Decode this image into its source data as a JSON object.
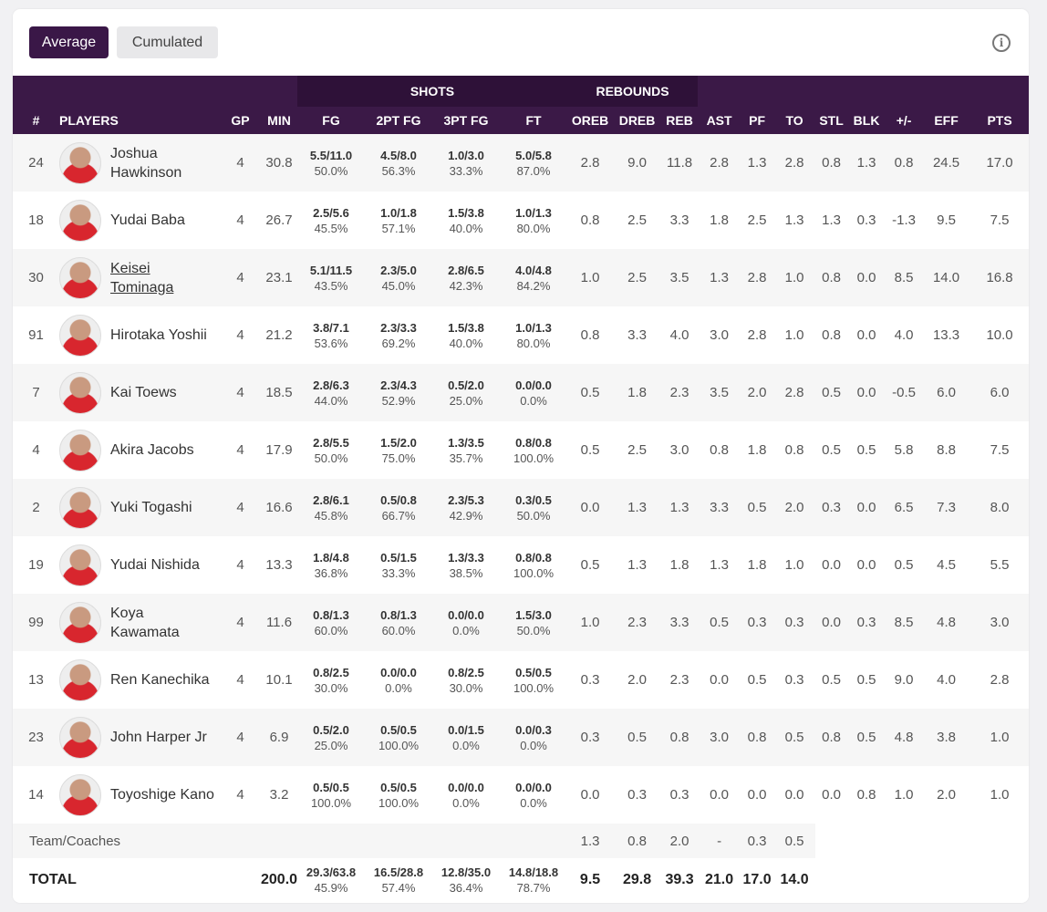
{
  "toolbar": {
    "average": "Average",
    "cumulated": "Cumulated",
    "info": "i"
  },
  "groups": {
    "shots": "SHOTS",
    "rebounds": "REBOUNDS"
  },
  "columns": [
    "#",
    "PLAYERS",
    "GP",
    "MIN",
    "FG",
    "2PT FG",
    "3PT FG",
    "FT",
    "OREB",
    "DREB",
    "REB",
    "AST",
    "PF",
    "TO",
    "STL",
    "BLK",
    "+/-",
    "EFF",
    "PTS"
  ],
  "players": [
    {
      "num": "24",
      "name": "Joshua Hawkinson",
      "link": false,
      "gp": "4",
      "min": "30.8",
      "fg": [
        "5.5/11.0",
        "50.0%"
      ],
      "fg2": [
        "4.5/8.0",
        "56.3%"
      ],
      "fg3": [
        "1.0/3.0",
        "33.3%"
      ],
      "ft": [
        "5.0/5.8",
        "87.0%"
      ],
      "oreb": "2.8",
      "dreb": "9.0",
      "reb": "11.8",
      "ast": "2.8",
      "pf": "1.3",
      "to": "2.8",
      "stl": "0.8",
      "blk": "1.3",
      "pm": "0.8",
      "eff": "24.5",
      "pts": "17.0"
    },
    {
      "num": "18",
      "name": "Yudai Baba",
      "link": false,
      "gp": "4",
      "min": "26.7",
      "fg": [
        "2.5/5.6",
        "45.5%"
      ],
      "fg2": [
        "1.0/1.8",
        "57.1%"
      ],
      "fg3": [
        "1.5/3.8",
        "40.0%"
      ],
      "ft": [
        "1.0/1.3",
        "80.0%"
      ],
      "oreb": "0.8",
      "dreb": "2.5",
      "reb": "3.3",
      "ast": "1.8",
      "pf": "2.5",
      "to": "1.3",
      "stl": "1.3",
      "blk": "0.3",
      "pm": "-1.3",
      "eff": "9.5",
      "pts": "7.5"
    },
    {
      "num": "30",
      "name": "Keisei Tominaga",
      "link": true,
      "gp": "4",
      "min": "23.1",
      "fg": [
        "5.1/11.5",
        "43.5%"
      ],
      "fg2": [
        "2.3/5.0",
        "45.0%"
      ],
      "fg3": [
        "2.8/6.5",
        "42.3%"
      ],
      "ft": [
        "4.0/4.8",
        "84.2%"
      ],
      "oreb": "1.0",
      "dreb": "2.5",
      "reb": "3.5",
      "ast": "1.3",
      "pf": "2.8",
      "to": "1.0",
      "stl": "0.8",
      "blk": "0.0",
      "pm": "8.5",
      "eff": "14.0",
      "pts": "16.8"
    },
    {
      "num": "91",
      "name": "Hirotaka Yoshii",
      "link": false,
      "wide": true,
      "gp": "4",
      "min": "21.2",
      "fg": [
        "3.8/7.1",
        "53.6%"
      ],
      "fg2": [
        "2.3/3.3",
        "69.2%"
      ],
      "fg3": [
        "1.5/3.8",
        "40.0%"
      ],
      "ft": [
        "1.0/1.3",
        "80.0%"
      ],
      "oreb": "0.8",
      "dreb": "3.3",
      "reb": "4.0",
      "ast": "3.0",
      "pf": "2.8",
      "to": "1.0",
      "stl": "0.8",
      "blk": "0.0",
      "pm": "4.0",
      "eff": "13.3",
      "pts": "10.0"
    },
    {
      "num": "7",
      "name": "Kai Toews",
      "link": false,
      "gp": "4",
      "min": "18.5",
      "fg": [
        "2.8/6.3",
        "44.0%"
      ],
      "fg2": [
        "2.3/4.3",
        "52.9%"
      ],
      "fg3": [
        "0.5/2.0",
        "25.0%"
      ],
      "ft": [
        "0.0/0.0",
        "0.0%"
      ],
      "oreb": "0.5",
      "dreb": "1.8",
      "reb": "2.3",
      "ast": "3.5",
      "pf": "2.0",
      "to": "2.8",
      "stl": "0.5",
      "blk": "0.0",
      "pm": "-0.5",
      "eff": "6.0",
      "pts": "6.0"
    },
    {
      "num": "4",
      "name": "Akira Jacobs",
      "link": false,
      "wide": true,
      "gp": "4",
      "min": "17.9",
      "fg": [
        "2.8/5.5",
        "50.0%"
      ],
      "fg2": [
        "1.5/2.0",
        "75.0%"
      ],
      "fg3": [
        "1.3/3.5",
        "35.7%"
      ],
      "ft": [
        "0.8/0.8",
        "100.0%"
      ],
      "oreb": "0.5",
      "dreb": "2.5",
      "reb": "3.0",
      "ast": "0.8",
      "pf": "1.8",
      "to": "0.8",
      "stl": "0.5",
      "blk": "0.5",
      "pm": "5.8",
      "eff": "8.8",
      "pts": "7.5"
    },
    {
      "num": "2",
      "name": "Yuki Togashi",
      "link": false,
      "wide": true,
      "gp": "4",
      "min": "16.6",
      "fg": [
        "2.8/6.1",
        "45.8%"
      ],
      "fg2": [
        "0.5/0.8",
        "66.7%"
      ],
      "fg3": [
        "2.3/5.3",
        "42.9%"
      ],
      "ft": [
        "0.3/0.5",
        "50.0%"
      ],
      "oreb": "0.0",
      "dreb": "1.3",
      "reb": "1.3",
      "ast": "3.3",
      "pf": "0.5",
      "to": "2.0",
      "stl": "0.3",
      "blk": "0.0",
      "pm": "6.5",
      "eff": "7.3",
      "pts": "8.0"
    },
    {
      "num": "19",
      "name": "Yudai Nishida",
      "link": false,
      "wide": true,
      "gp": "4",
      "min": "13.3",
      "fg": [
        "1.8/4.8",
        "36.8%"
      ],
      "fg2": [
        "0.5/1.5",
        "33.3%"
      ],
      "fg3": [
        "1.3/3.3",
        "38.5%"
      ],
      "ft": [
        "0.8/0.8",
        "100.0%"
      ],
      "oreb": "0.5",
      "dreb": "1.3",
      "reb": "1.8",
      "ast": "1.3",
      "pf": "1.8",
      "to": "1.0",
      "stl": "0.0",
      "blk": "0.0",
      "pm": "0.5",
      "eff": "4.5",
      "pts": "5.5"
    },
    {
      "num": "99",
      "name": "Koya Kawamata",
      "link": false,
      "gp": "4",
      "min": "11.6",
      "fg": [
        "0.8/1.3",
        "60.0%"
      ],
      "fg2": [
        "0.8/1.3",
        "60.0%"
      ],
      "fg3": [
        "0.0/0.0",
        "0.0%"
      ],
      "ft": [
        "1.5/3.0",
        "50.0%"
      ],
      "oreb": "1.0",
      "dreb": "2.3",
      "reb": "3.3",
      "ast": "0.5",
      "pf": "0.3",
      "to": "0.3",
      "stl": "0.0",
      "blk": "0.3",
      "pm": "8.5",
      "eff": "4.8",
      "pts": "3.0"
    },
    {
      "num": "13",
      "name": "Ren Kanechika",
      "link": false,
      "wide": true,
      "gp": "4",
      "min": "10.1",
      "fg": [
        "0.8/2.5",
        "30.0%"
      ],
      "fg2": [
        "0.0/0.0",
        "0.0%"
      ],
      "fg3": [
        "0.8/2.5",
        "30.0%"
      ],
      "ft": [
        "0.5/0.5",
        "100.0%"
      ],
      "oreb": "0.3",
      "dreb": "2.0",
      "reb": "2.3",
      "ast": "0.0",
      "pf": "0.5",
      "to": "0.3",
      "stl": "0.5",
      "blk": "0.5",
      "pm": "9.0",
      "eff": "4.0",
      "pts": "2.8"
    },
    {
      "num": "23",
      "name": "John Harper Jr",
      "link": false,
      "wide": true,
      "gp": "4",
      "min": "6.9",
      "fg": [
        "0.5/2.0",
        "25.0%"
      ],
      "fg2": [
        "0.5/0.5",
        "100.0%"
      ],
      "fg3": [
        "0.0/1.5",
        "0.0%"
      ],
      "ft": [
        "0.0/0.3",
        "0.0%"
      ],
      "oreb": "0.3",
      "dreb": "0.5",
      "reb": "0.8",
      "ast": "3.0",
      "pf": "0.8",
      "to": "0.5",
      "stl": "0.8",
      "blk": "0.5",
      "pm": "4.8",
      "eff": "3.8",
      "pts": "1.0"
    },
    {
      "num": "14",
      "name": "Toyoshige Kano",
      "link": false,
      "wide": true,
      "gp": "4",
      "min": "3.2",
      "fg": [
        "0.5/0.5",
        "100.0%"
      ],
      "fg2": [
        "0.5/0.5",
        "100.0%"
      ],
      "fg3": [
        "0.0/0.0",
        "0.0%"
      ],
      "ft": [
        "0.0/0.0",
        "0.0%"
      ],
      "oreb": "0.0",
      "dreb": "0.3",
      "reb": "0.3",
      "ast": "0.0",
      "pf": "0.0",
      "to": "0.0",
      "stl": "0.0",
      "blk": "0.8",
      "pm": "1.0",
      "eff": "2.0",
      "pts": "1.0"
    }
  ],
  "team": {
    "label": "Team/Coaches",
    "oreb": "1.3",
    "dreb": "0.8",
    "reb": "2.0",
    "ast": "-",
    "pf": "0.3",
    "to": "0.5"
  },
  "total": {
    "label": "TOTAL",
    "min": "200.0",
    "fg": [
      "29.3/63.8",
      "45.9%"
    ],
    "fg2": [
      "16.5/28.8",
      "57.4%"
    ],
    "fg3": [
      "12.8/35.0",
      "36.4%"
    ],
    "ft": [
      "14.8/18.8",
      "78.7%"
    ],
    "oreb": "9.5",
    "dreb": "29.8",
    "reb": "39.3",
    "ast": "21.0",
    "pf": "17.0",
    "to": "14.0"
  },
  "colors": {
    "header": "#3b1947",
    "group_header": "#2e1138",
    "accent": "#3a1747"
  }
}
